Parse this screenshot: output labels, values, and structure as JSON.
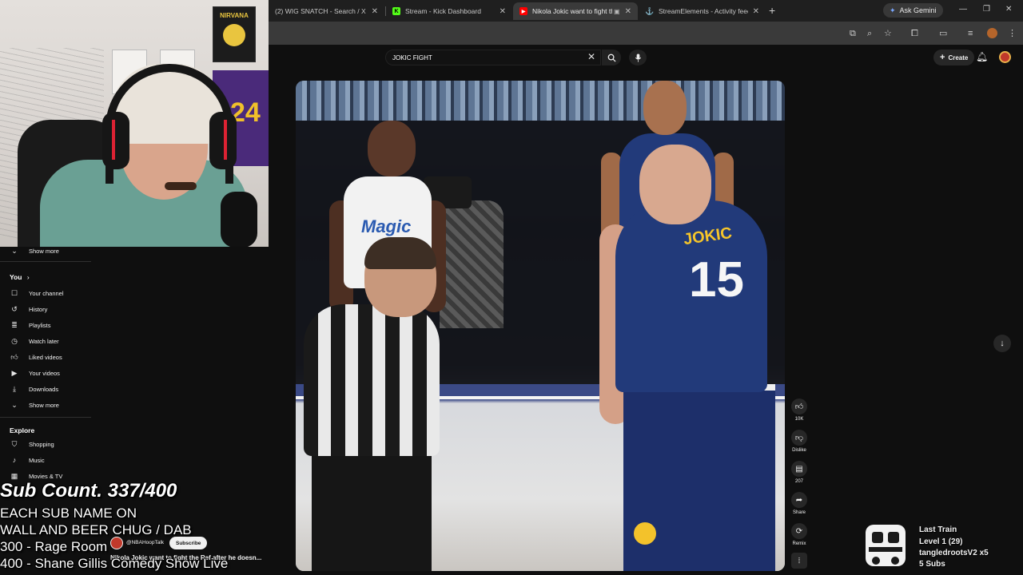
{
  "browser": {
    "tabs": [
      {
        "title": "(2) WIG SNATCH - Search / X",
        "favicon": "x-logo-icon",
        "active": false
      },
      {
        "title": "Stream - Kick Dashboard",
        "favicon": "kick-logo-icon",
        "active": false
      },
      {
        "title": "Nikola Jokic want to fight th",
        "favicon": "youtube-logo-icon",
        "active": true
      },
      {
        "title": "StreamElements - Activity feed",
        "favicon": "streamelements-logo-icon",
        "active": false
      }
    ],
    "ask_gemini_label": "Ask Gemini",
    "new_tab_symbol": "+"
  },
  "youtube": {
    "search": {
      "value": "JOKIC FIGHT"
    },
    "create_label": "Create"
  },
  "sidebar": {
    "show_more_top": "Show more",
    "you_heading": "You",
    "you_items": [
      {
        "label": "Your channel",
        "icon": "channel-icon"
      },
      {
        "label": "History",
        "icon": "history-icon"
      },
      {
        "label": "Playlists",
        "icon": "playlists-icon"
      },
      {
        "label": "Watch later",
        "icon": "clock-icon"
      },
      {
        "label": "Liked videos",
        "icon": "thumbs-up-icon"
      },
      {
        "label": "Your videos",
        "icon": "video-icon"
      },
      {
        "label": "Downloads",
        "icon": "download-icon"
      }
    ],
    "show_more_bottom": "Show more",
    "explore_heading": "Explore",
    "explore_items": [
      {
        "label": "Shopping",
        "icon": "shopping-bag-icon"
      },
      {
        "label": "Music",
        "icon": "music-note-icon"
      },
      {
        "label": "Movies & TV",
        "icon": "film-icon"
      }
    ]
  },
  "video": {
    "jersey_name": "JOKIC",
    "jersey_number": "15",
    "magic_jersey_text": "Magic",
    "channel_handle": "@NBAHoopTalk",
    "subscribe_label": "Subscribe",
    "title": "Nikola Jokic want to fight the Ref after he doesn..."
  },
  "actions": [
    {
      "name": "like",
      "icon": "thumbs-up-icon",
      "label": "10K"
    },
    {
      "name": "dislike",
      "icon": "thumbs-down-icon",
      "label": "Dislike"
    },
    {
      "name": "comments",
      "icon": "comment-icon",
      "label": "207"
    },
    {
      "name": "share",
      "icon": "share-icon",
      "label": "Share"
    },
    {
      "name": "remix",
      "icon": "remix-icon",
      "label": "Remix"
    }
  ],
  "stream_overlay": {
    "title": "Sub Count. 337/400",
    "lines": [
      "EACH SUB NAME ON",
      "WALL AND BEER CHUG / DAB",
      "300 - Rage Room",
      "400 - Shane Gillis Comedy Show Live"
    ]
  },
  "webcam": {
    "poster_text": "NIRVANA",
    "jersey_number": "24"
  },
  "last_train": {
    "title": "Last Train",
    "level": "Level 1  (29)",
    "user": "tangledrootsV2 x5",
    "subs": "5 Subs"
  }
}
